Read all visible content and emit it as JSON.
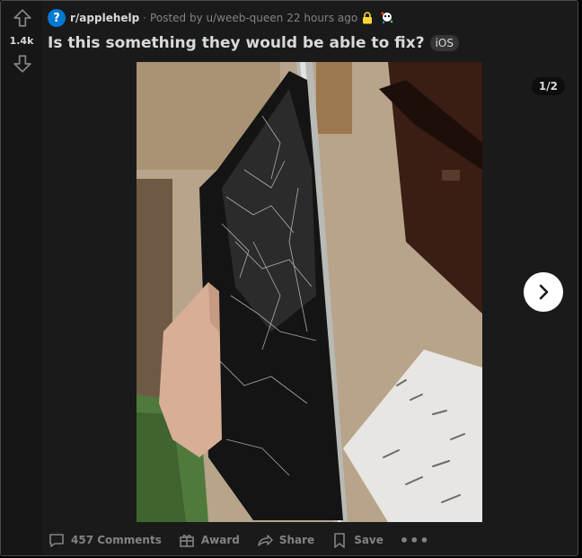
{
  "vote": {
    "score": "1.4k"
  },
  "meta": {
    "subreddit_icon_glyph": "?",
    "subreddit": "r/applehelp",
    "separator": "·",
    "posted_by": "Posted by u/weeb-queen",
    "age": "22 hours ago"
  },
  "post": {
    "title": "Is this something they would be able to fix?",
    "flair": "iOS"
  },
  "gallery": {
    "counter": "1/2"
  },
  "actions": {
    "comments": "457 Comments",
    "award": "Award",
    "share": "Share",
    "save": "Save",
    "more": "•••"
  },
  "colors": {
    "background": "#1a1a1b",
    "text": "#d7dadc",
    "muted": "#818384",
    "subreddit_icon": "#0079d3",
    "lock": "#ffd635"
  },
  "icons": [
    "upvote-icon",
    "downvote-icon",
    "lock-icon",
    "award-badge-icon",
    "chevron-right-icon",
    "comment-icon",
    "gift-icon",
    "share-icon",
    "bookmark-icon"
  ]
}
